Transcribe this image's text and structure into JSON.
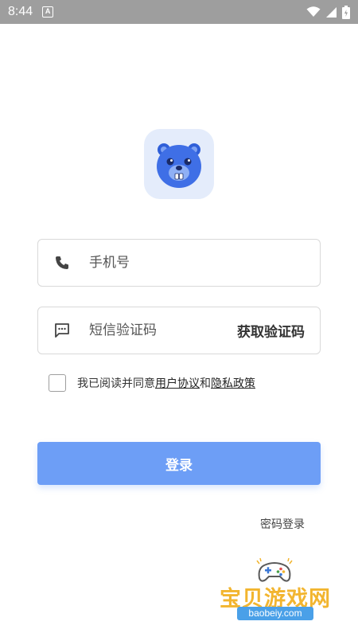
{
  "status_bar": {
    "time": "8:44",
    "notification_icon": "a-letter-icon",
    "wifi_icon": "wifi-icon",
    "signal_icon": "signal-icon",
    "battery_icon": "battery-icon"
  },
  "app": {
    "logo_icon": "beaver-mascot-icon",
    "logo_bg_color": "#e4ecfb",
    "accent_color": "#6d9ef6"
  },
  "form": {
    "phone": {
      "icon": "phone-icon",
      "placeholder": "手机号",
      "value": ""
    },
    "sms_code": {
      "icon": "message-icon",
      "placeholder": "短信验证码",
      "value": ""
    },
    "get_code_label": "获取验证码"
  },
  "agreement": {
    "checked": false,
    "prefix": "我已阅读并同意",
    "user_agreement": "用户协议",
    "conjunction": "和",
    "privacy_policy": "隐私政策"
  },
  "login_button": "登录",
  "password_login_link": "密码登录",
  "watermark": {
    "title": "宝贝游戏网",
    "url": "baobeiy.com",
    "icon": "gamepad-icon"
  }
}
